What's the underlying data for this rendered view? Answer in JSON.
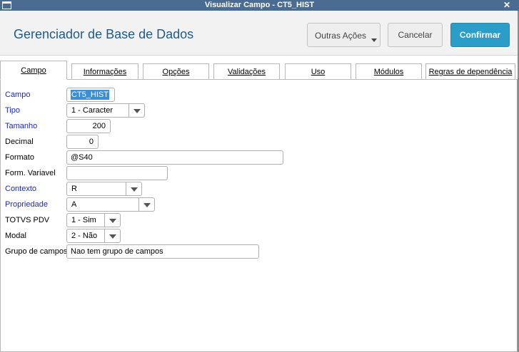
{
  "window": {
    "title": "Visualizar Campo - CT5_HIST"
  },
  "header": {
    "app_title": "Gerenciador de Base de Dados",
    "buttons": {
      "outras_acoes": "Outras Ações",
      "cancelar": "Cancelar",
      "confirmar": "Confirmar"
    }
  },
  "tabs": [
    {
      "label": "Campo",
      "active": true
    },
    {
      "label": "Informações"
    },
    {
      "label": "Opções"
    },
    {
      "label": "Validações"
    },
    {
      "label": "Uso"
    },
    {
      "label": "Módulos"
    },
    {
      "label": "Regras de dependência"
    }
  ],
  "form": {
    "campo": {
      "label": "Campo",
      "value": "CT5_HIST"
    },
    "tipo": {
      "label": "Tipo",
      "value": "1 - Caracter"
    },
    "tamanho": {
      "label": "Tamanho",
      "value": "200"
    },
    "decimal": {
      "label": "Decimal",
      "value": "0"
    },
    "formato": {
      "label": "Formato",
      "value": "@S40"
    },
    "form_variavel": {
      "label": "Form. Variavel",
      "value": ""
    },
    "contexto": {
      "label": "Contexto",
      "value": "R"
    },
    "propriedade": {
      "label": "Propriedade",
      "value": "A"
    },
    "totvs_pdv": {
      "label": "TOTVS PDV",
      "value": "1 - Sim"
    },
    "modal": {
      "label": "Modal",
      "value": "2 - Não"
    },
    "grupo_campos": {
      "label": "Grupo de campos",
      "value": "Nao tem grupo de campos"
    }
  },
  "colors": {
    "title_bar": "#4a6b92",
    "accent": "#2a9ec9",
    "required_label": "#1c2bb3",
    "app_title": "#1f5a8a"
  }
}
